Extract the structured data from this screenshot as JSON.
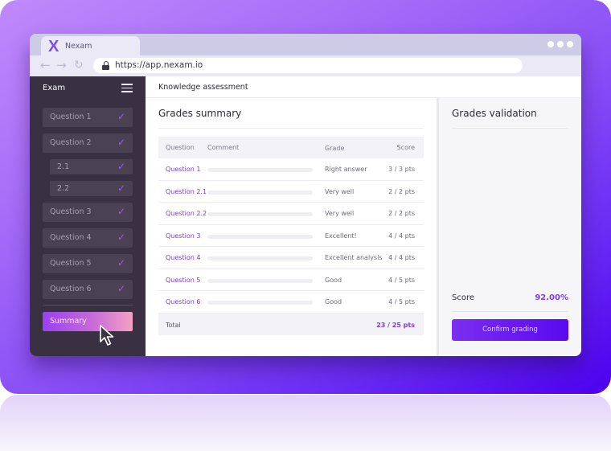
{
  "browser": {
    "tab_title": "Nexam",
    "logo_glyph": "X",
    "url": "https://app.nexam.io",
    "nav_icons": {
      "back": "←",
      "forward": "→",
      "reload": "↻"
    }
  },
  "sidebar": {
    "title": "Exam",
    "check_glyph": "✓",
    "items": [
      {
        "label": "Question 1",
        "done": true
      },
      {
        "label": "Question 2",
        "done": true
      },
      {
        "label": "2.1",
        "done": true
      },
      {
        "label": "2.2",
        "done": true
      },
      {
        "label": "Question 3",
        "done": true
      },
      {
        "label": "Question 4",
        "done": true
      },
      {
        "label": "Question 5",
        "done": true
      },
      {
        "label": "Question 6",
        "done": true
      }
    ],
    "summary_label": "Summary"
  },
  "header": {
    "title": "Knowledge assessment"
  },
  "grades_summary": {
    "title": "Grades summary",
    "columns": {
      "question": "Question",
      "comment": "Comment",
      "grade": "Grade",
      "score": "Score"
    },
    "rows": [
      {
        "question": "Question 1",
        "comment": "",
        "grade": "Right answer",
        "score": "3 / 3 pts"
      },
      {
        "question": "Question 2.1",
        "comment": "",
        "grade": "Very well",
        "score": "2 / 2 pts"
      },
      {
        "question": "Question 2.2",
        "comment": "",
        "grade": "Very well",
        "score": "2 / 2 pts"
      },
      {
        "question": "Question 3",
        "comment": "",
        "grade": "Excellent!",
        "score": "4 / 4 pts"
      },
      {
        "question": "Question 4",
        "comment": "",
        "grade": "Excellent analysis",
        "score": "4 / 4 pts"
      },
      {
        "question": "Question 5",
        "comment": "",
        "grade": "Good",
        "score": "4 / 5 pts"
      },
      {
        "question": "Question 6",
        "comment": "",
        "grade": "Good",
        "score": "4 / 5 pts"
      }
    ],
    "total_label": "Total",
    "total_score": "23 / 25 pts"
  },
  "grades_validation": {
    "title": "Grades validation",
    "score_label": "Score",
    "score_value": "92.00%",
    "confirm_label": "Confirm grading"
  },
  "colors": {
    "accent": "#7a3de6",
    "sidebar_bg": "#393141",
    "check": "#9a5cf0",
    "confirm_button": "#6a1cf0"
  }
}
